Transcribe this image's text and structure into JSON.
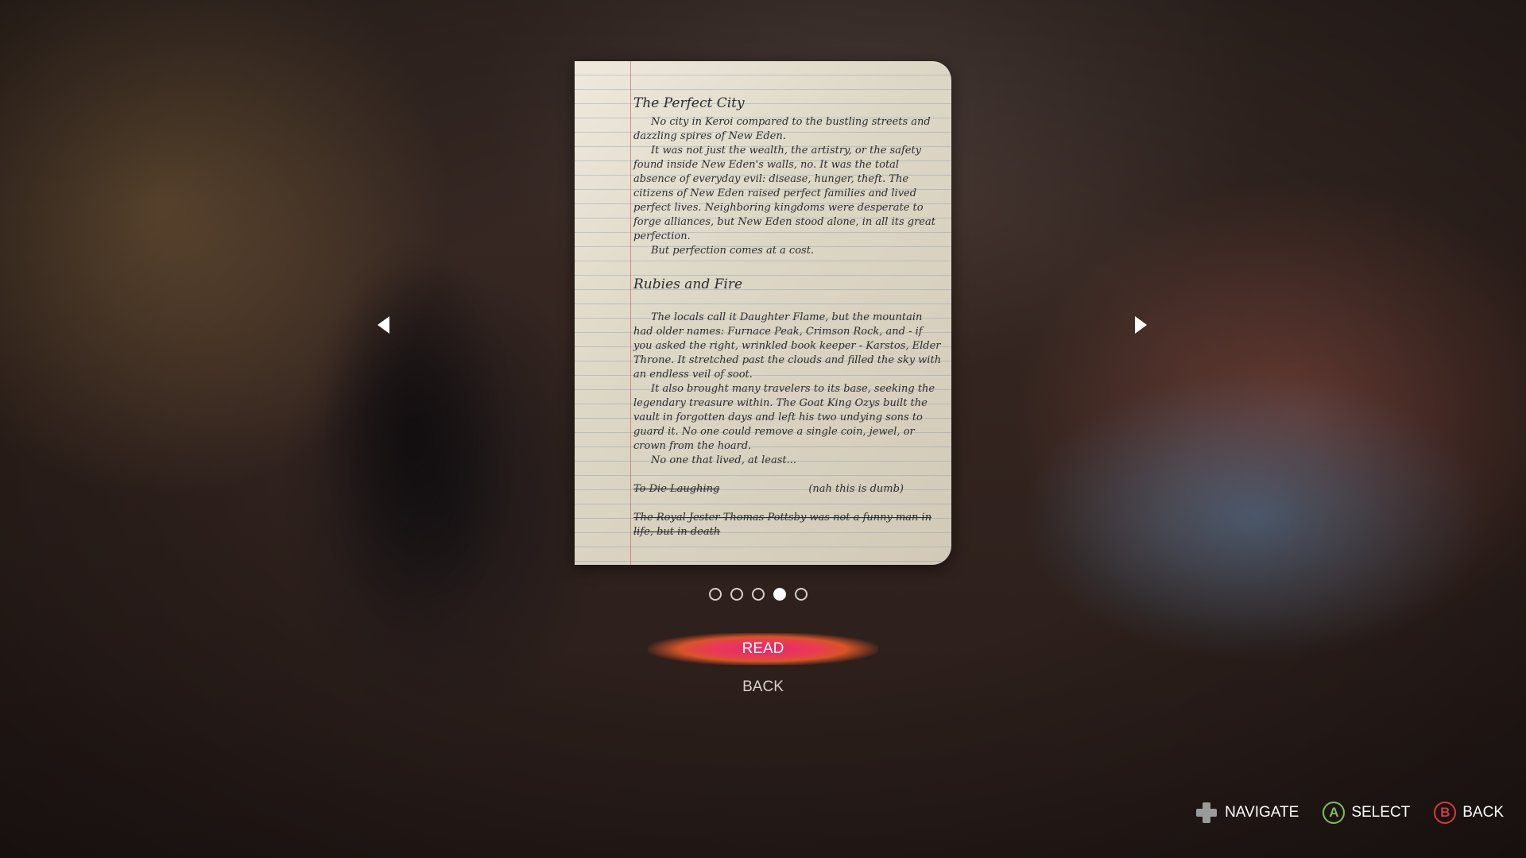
{
  "page": {
    "paper": {
      "title": "The Perfect City",
      "p1": "No city in Keroi compared to the bustling streets and dazzling spires of New Eden.",
      "p2": "It was not just the wealth, the artistry, or the safety found inside New Eden's walls, no. It was the total absence of everyday evil: disease, hunger, theft. The citizens of New Eden raised perfect families and lived perfect lives. Neighboring kingdoms were desperate to forge alliances, but New Eden stood alone, in all its great perfection.",
      "p3": "But perfection comes at a cost.",
      "subtitle": "Rubies and Fire",
      "p4": "The locals call it Daughter Flame, but the mountain had older names: Furnace Peak, Crimson Rock, and - if you asked the right, wrinkled book keeper - Karstos, Elder Throne. It stretched past the clouds and filled the sky with an endless veil of soot.",
      "p5": "It also brought many travelers to its base, seeking the legendary treasure within. The Goat King Ozys built the vault in forgotten days and left his two undying sons to guard it. No one could remove a single coin, jewel, or crown from the hoard.",
      "p6": "No one that lived, at least...",
      "struck_title": "To Die Laughing",
      "aside_note": "(nah this is dumb)",
      "struck_line": "The Royal Jester Thomas Pottsby was not a funny man in life, but in death"
    },
    "pagination": {
      "current": 4,
      "total": 5
    },
    "menu": {
      "read": "READ",
      "back": "BACK"
    },
    "hints": {
      "navigate": "NAVIGATE",
      "select": "SELECT",
      "back": "BACK",
      "a_glyph": "A",
      "b_glyph": "B"
    }
  }
}
